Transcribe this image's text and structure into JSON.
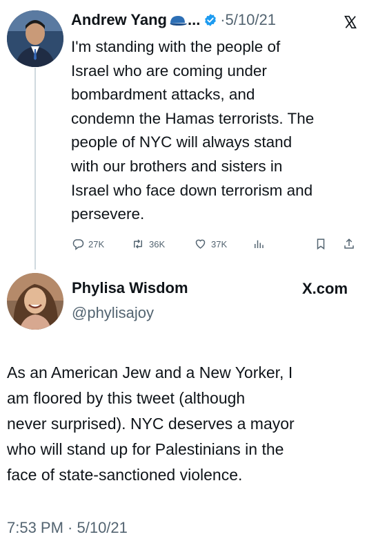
{
  "tweet": {
    "author_name": "Andrew Yang",
    "name_truncation": "...",
    "date": "·5/10/21",
    "text": "I'm standing with the people of\nIsrael who are coming under\nbombardment attacks, and\ncondemn the Hamas terrorists. The\npeople of NYC will always stand\nwith our brothers and sisters in\nIsrael who face down terrorism and\npersevere.",
    "replies": "27K",
    "retweets": "36K",
    "likes": "37K"
  },
  "quote": {
    "author_name": "Phylisa Wisdom",
    "handle": "@phylisajoy",
    "source": "X.com",
    "text": "As an American Jew and a New Yorker, I\nam floored by this tweet (although\nnever surprised). NYC deserves a mayor\nwho will stand up for Palestinians in the\nface of state-sanctioned violence.",
    "timestamp": "7:53 PM · 5/10/21"
  },
  "colors": {
    "text": "#0f1419",
    "muted": "#536471",
    "verified": "#1d9bf0",
    "divider": "#cfd9de"
  }
}
